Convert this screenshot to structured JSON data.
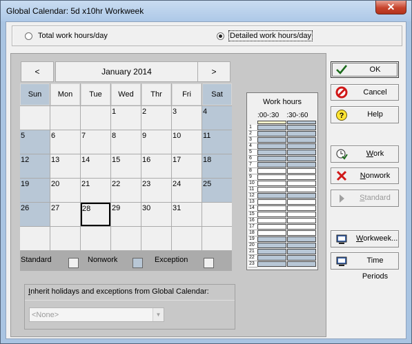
{
  "window": {
    "title": "Global Calendar: 5d x10hr Workweek",
    "close_glyph": "✕"
  },
  "mode": {
    "total_label": "Total work hours/day",
    "detailed_label": "Detailed work hours/day",
    "selected": "detailed"
  },
  "calendar": {
    "prev_glyph": "<",
    "next_glyph": ">",
    "month_label": "January 2014",
    "day_headers": [
      "Sun",
      "Mon",
      "Tue",
      "Wed",
      "Thr",
      "Fri",
      "Sat"
    ],
    "weeks": [
      [
        "",
        "",
        "",
        "1",
        "2",
        "3",
        "4"
      ],
      [
        "5",
        "6",
        "7",
        "8",
        "9",
        "10",
        "11"
      ],
      [
        "12",
        "13",
        "14",
        "15",
        "16",
        "17",
        "18"
      ],
      [
        "19",
        "20",
        "21",
        "22",
        "23",
        "24",
        "25"
      ],
      [
        "26",
        "27",
        "28",
        "29",
        "30",
        "31",
        ""
      ],
      [
        "",
        "",
        "",
        "",
        "",
        "",
        ""
      ]
    ],
    "selected_day": "28"
  },
  "legend": {
    "standard": "Standard",
    "nonwork": "Nonwork",
    "exception": "Exception"
  },
  "inherit": {
    "label": "Inherit holidays and exceptions from Global Calendar:",
    "value": "<None>"
  },
  "work_hours": {
    "title": "Work hours",
    "col_labels": ":00-:30    :30-:60",
    "hours": [
      "1",
      "2",
      "3",
      "4",
      "5",
      "6",
      "7",
      "8",
      "9",
      "10",
      "11",
      "12",
      "13",
      "14",
      "15",
      "16",
      "17",
      "18",
      "19",
      "20",
      "21",
      "22",
      "23"
    ],
    "work_hours_set": [
      "8",
      "9",
      "10",
      "11",
      "13",
      "14",
      "15",
      "16",
      "17",
      "18"
    ]
  },
  "buttons": {
    "ok": "OK",
    "cancel": "Cancel",
    "help": "Help",
    "work": "Work",
    "nonwork": "Nonwork",
    "standard": "Standard",
    "workweek": "Workweek...",
    "time_periods": "Time Periods"
  },
  "colors": {
    "nonwork": "#b8c7d6",
    "work": "#ffffff",
    "accent": "#1c6b1c"
  }
}
